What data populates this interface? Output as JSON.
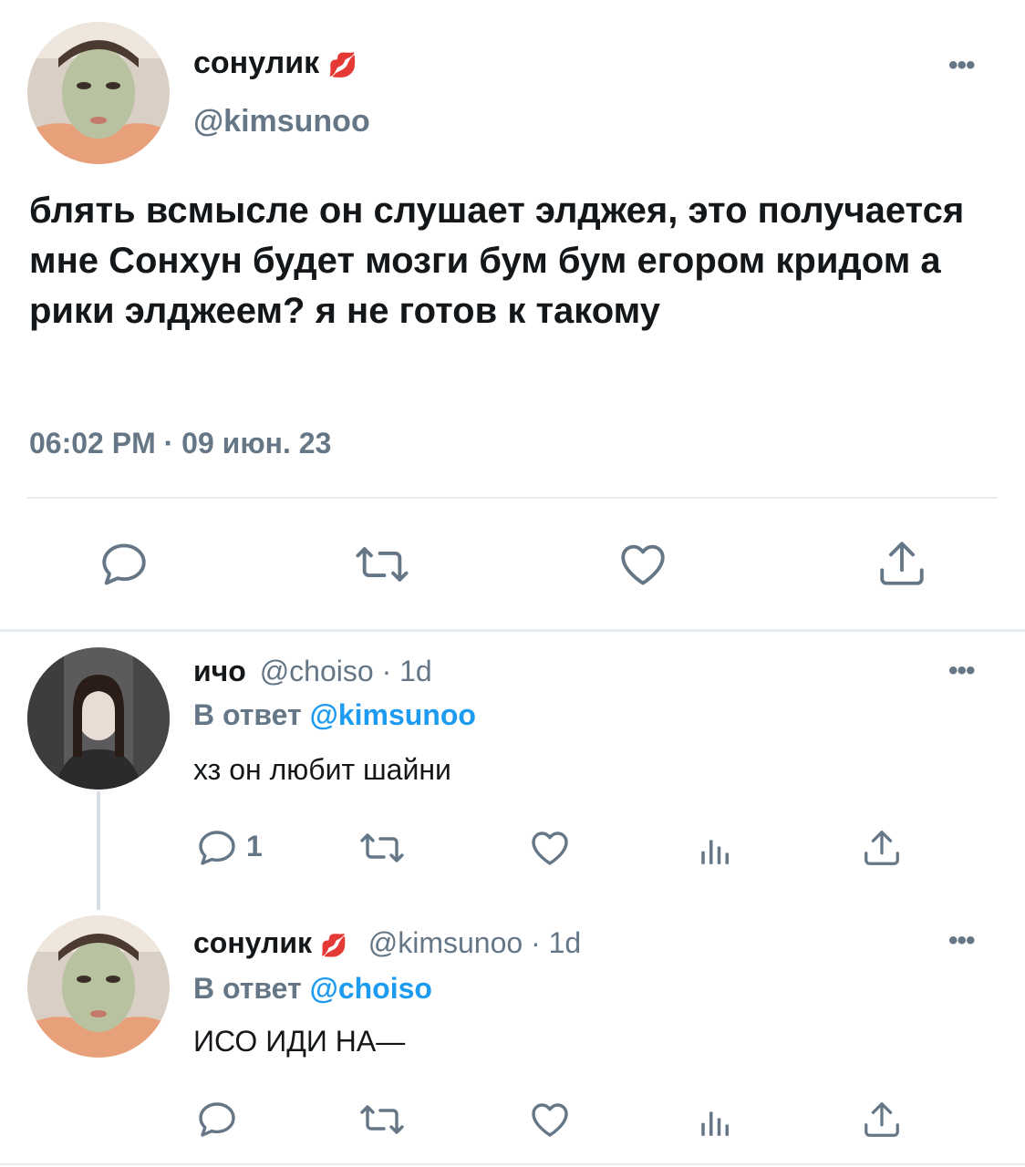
{
  "main_tweet": {
    "author": {
      "display_name": "сонулик",
      "emoji": "💋",
      "handle": "@kimsunoo"
    },
    "text": "блять всмысле он слушает элджея, это получается мне Сонхун будет мозги бум бум егором кридом а рики элджеем? я не готов к такому",
    "timestamp": "06:02 PM · 09 июн. 23",
    "icons": [
      "reply-icon",
      "retweet-icon",
      "like-icon",
      "share-icon"
    ]
  },
  "replies": [
    {
      "author": {
        "display_name": "ичо",
        "handle": "@choiso",
        "age": "· 1d"
      },
      "reply_prefix": "В ответ",
      "reply_to": "@kimsunoo",
      "text": "хз он любит шайни",
      "reply_count": "1",
      "icons": [
        "reply-icon",
        "retweet-icon",
        "like-icon",
        "views-icon",
        "share-icon"
      ]
    },
    {
      "author": {
        "display_name": "сонулик",
        "emoji": "💋",
        "handle": "@kimsunoo",
        "age": "· 1d"
      },
      "reply_prefix": "В ответ",
      "reply_to": "@choiso",
      "text": "ИСО ИДИ НА—",
      "icons": [
        "reply-icon",
        "retweet-icon",
        "like-icon",
        "views-icon",
        "share-icon"
      ]
    }
  ],
  "colors": {
    "accent": "#1d9bf0",
    "muted": "#657786",
    "text": "#14171a",
    "divider": "#e6ecf0"
  }
}
